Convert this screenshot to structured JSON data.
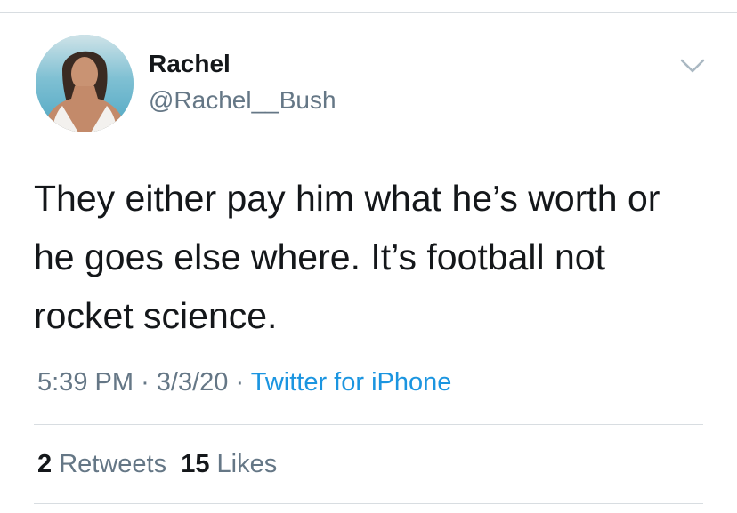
{
  "tweet": {
    "author": {
      "display_name": "Rachel",
      "handle": "@Rachel__Bush",
      "avatar": "profile-photo"
    },
    "menu_icon": "chevron-down-icon",
    "text": "They either pay him what he’s worth or he goes else where. It’s football not rocket science.",
    "time": "5:39 PM",
    "date": "3/3/20",
    "separator": "·",
    "source": "Twitter for iPhone",
    "stats": {
      "retweets_count": "2",
      "retweets_label": "Retweets",
      "likes_count": "15",
      "likes_label": "Likes"
    }
  },
  "colors": {
    "text_primary": "#14171a",
    "text_secondary": "#657786",
    "link": "#1b95e0",
    "divider": "#d8dde1"
  }
}
